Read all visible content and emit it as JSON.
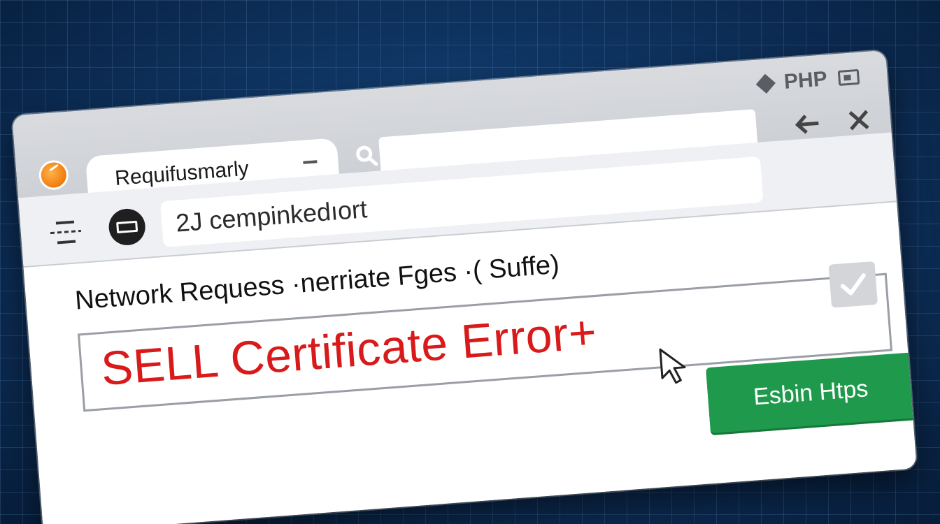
{
  "tab": {
    "title": "Requifusmarly"
  },
  "titlebar": {
    "tech_label": "PHP"
  },
  "toolbar": {
    "url": "2J cempinkedıort"
  },
  "main": {
    "heading": "Network Requess ·nerriate Fges ·( Suffe)",
    "cert_error": "SELL Certificate Error+",
    "checkbox_checked": true,
    "action_button": "Esbin Htps"
  },
  "colors": {
    "error_red": "#d81a1a",
    "button_green": "#1f9a4d",
    "background_blue": "#0f3563",
    "favicon_orange": "#f07a10"
  }
}
